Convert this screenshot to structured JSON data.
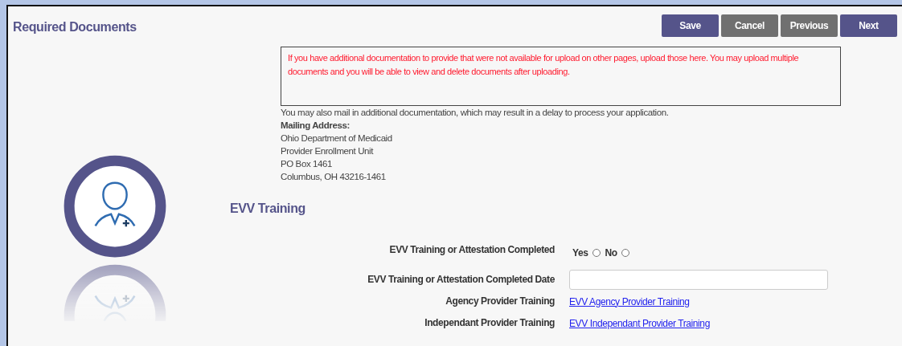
{
  "title": "Required Documents",
  "buttons": [
    {
      "label": "Save",
      "kind": "primary"
    },
    {
      "label": "Cancel",
      "kind": "secondary"
    },
    {
      "label": "Previous",
      "kind": "secondary"
    },
    {
      "label": "Next",
      "kind": "primary"
    }
  ],
  "notice": "If you have additional documentation to provide that were not available for upload on other pages, upload those here. You may upload multiple documents and you will be able to view and delete documents after uploading.",
  "mail_note": "You may also mail in additional documentation, which may result in a delay to process your application.",
  "mailing_address": {
    "label": "Mailing Address:",
    "lines": [
      "Ohio Department of Medicaid",
      "Provider Enrollment Unit",
      "PO Box 1461",
      "Columbus, OH 43216-1461"
    ]
  },
  "section": {
    "title": "EVV Training",
    "rows": [
      {
        "kind": "radio",
        "label": "EVV Training or Attestation Completed",
        "options": [
          {
            "label": "Yes",
            "selected": false
          },
          {
            "label": "No",
            "selected": false
          }
        ]
      },
      {
        "kind": "input",
        "label": "EVV Training or Attestation Completed Date"
      },
      {
        "kind": "link",
        "label": "Agency Provider Training",
        "link": "EVV Agency Provider Training"
      },
      {
        "kind": "link",
        "label": "Independant Provider Training",
        "link": "EVV Independant Provider Training"
      }
    ]
  }
}
